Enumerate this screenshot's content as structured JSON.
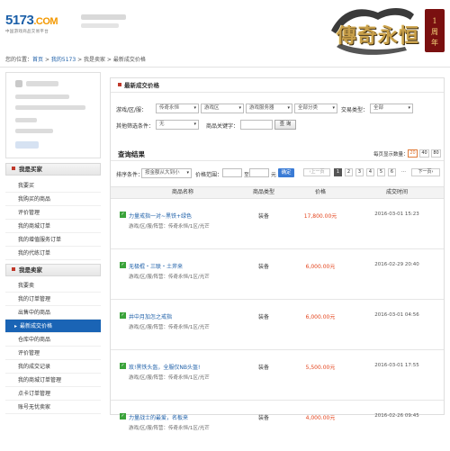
{
  "header": {
    "logo_main": "5173",
    "logo_suffix": ".COM",
    "logo_tagline": "中国游戏商品交易平台",
    "banner_title": "傳奇永恒"
  },
  "breadcrumb": {
    "prefix": "您的位置：",
    "home": "首页",
    "sep1": " > ",
    "my": "我的5173",
    "sep2": " > ",
    "seller": "我是卖家",
    "sep3": " > ",
    "current": "最新成交价格"
  },
  "sidebar": {
    "buyer_title": "我是买家",
    "buyer_items": [
      "我要买",
      "我购买的商品",
      "评价管理",
      "我的商城订单",
      "我的增值服务订单",
      "我的代练订单"
    ],
    "seller_title": "我是卖家",
    "seller_items": [
      "我要卖",
      "我的订单管理",
      "出售中的商品",
      "最新成交价格",
      "仓库中的商品",
      "评价管理",
      "我的成交记录",
      "我的商城订单管理",
      "点卡订单管理",
      "账号无忧卖家"
    ],
    "active_item": "最新成交价格"
  },
  "panel": {
    "title": "最新成交价格",
    "filter": {
      "game_area_label": "游戏/区/服：",
      "game_value": "传奇永恒",
      "area_value": "游戏区",
      "server_value": "游戏服务器",
      "category_value": "全部分类",
      "trade_type_label": "交易类型：",
      "trade_type_value": "全部",
      "other_label": "其他筛选条件：",
      "other_value": "无",
      "keyword_label": "商品关键字：",
      "search_button": "查 询"
    },
    "results": {
      "title": "查询结果",
      "per_page_label": "每页显示数量：",
      "per_page_options": [
        "20",
        "40",
        "80"
      ],
      "per_page_selected": "20",
      "sort_label": "排序条件：",
      "sort_value": "按金额从大到小",
      "price_range_label": "价格范围：",
      "price_to": "至",
      "price_unit": "元",
      "confirm_button": "确定",
      "prev_button": "上一页",
      "pages": [
        "1",
        "2",
        "3",
        "4",
        "5",
        "6"
      ],
      "current_page": "1",
      "next_button": "下一页"
    },
    "table": {
      "headers": [
        "商品名称",
        "商品类型",
        "价格",
        "成交时间"
      ],
      "rows": [
        {
          "name": "力量戒指一对~黑铁+绿色",
          "meta": "游戏/区/服/阵营：传奇永恒/1区/光芒",
          "type": "装备",
          "price": "17,800.00元",
          "time": "2016-03-01 15:23"
        },
        {
          "name": "无极棍・三联・土斧来",
          "meta": "游戏/区/服/阵营：传奇永恒/1区/光芒",
          "type": "装备",
          "price": "6,000.00元",
          "time": "2016-02-29 20:40"
        },
        {
          "name": "井中月加怎之戒指",
          "meta": "游戏/区/服/阵营：传奇永恒/1区/光芒",
          "type": "装备",
          "price": "6,000.00元",
          "time": "2016-03-01 04:56"
        },
        {
          "name": "玫!黑铁头盔，全服仅NB头盔!",
          "meta": "游戏/区/服/阵营：传奇永恒/1区/光芒",
          "type": "装备",
          "price": "5,500.00元",
          "time": "2016-03-01 17:55"
        },
        {
          "name": "力量战士的最爱，名板来",
          "meta": "游戏/区/服/阵营：传奇永恒/1区/光芒",
          "type": "装备",
          "price": "4,000.00元",
          "time": "2016-02-26 09:45"
        }
      ]
    }
  },
  "colors": {
    "brand_blue": "#1d5fa8",
    "accent_orange": "#f39800",
    "price_red": "#e3431b",
    "active_blue": "#1a64b5"
  }
}
